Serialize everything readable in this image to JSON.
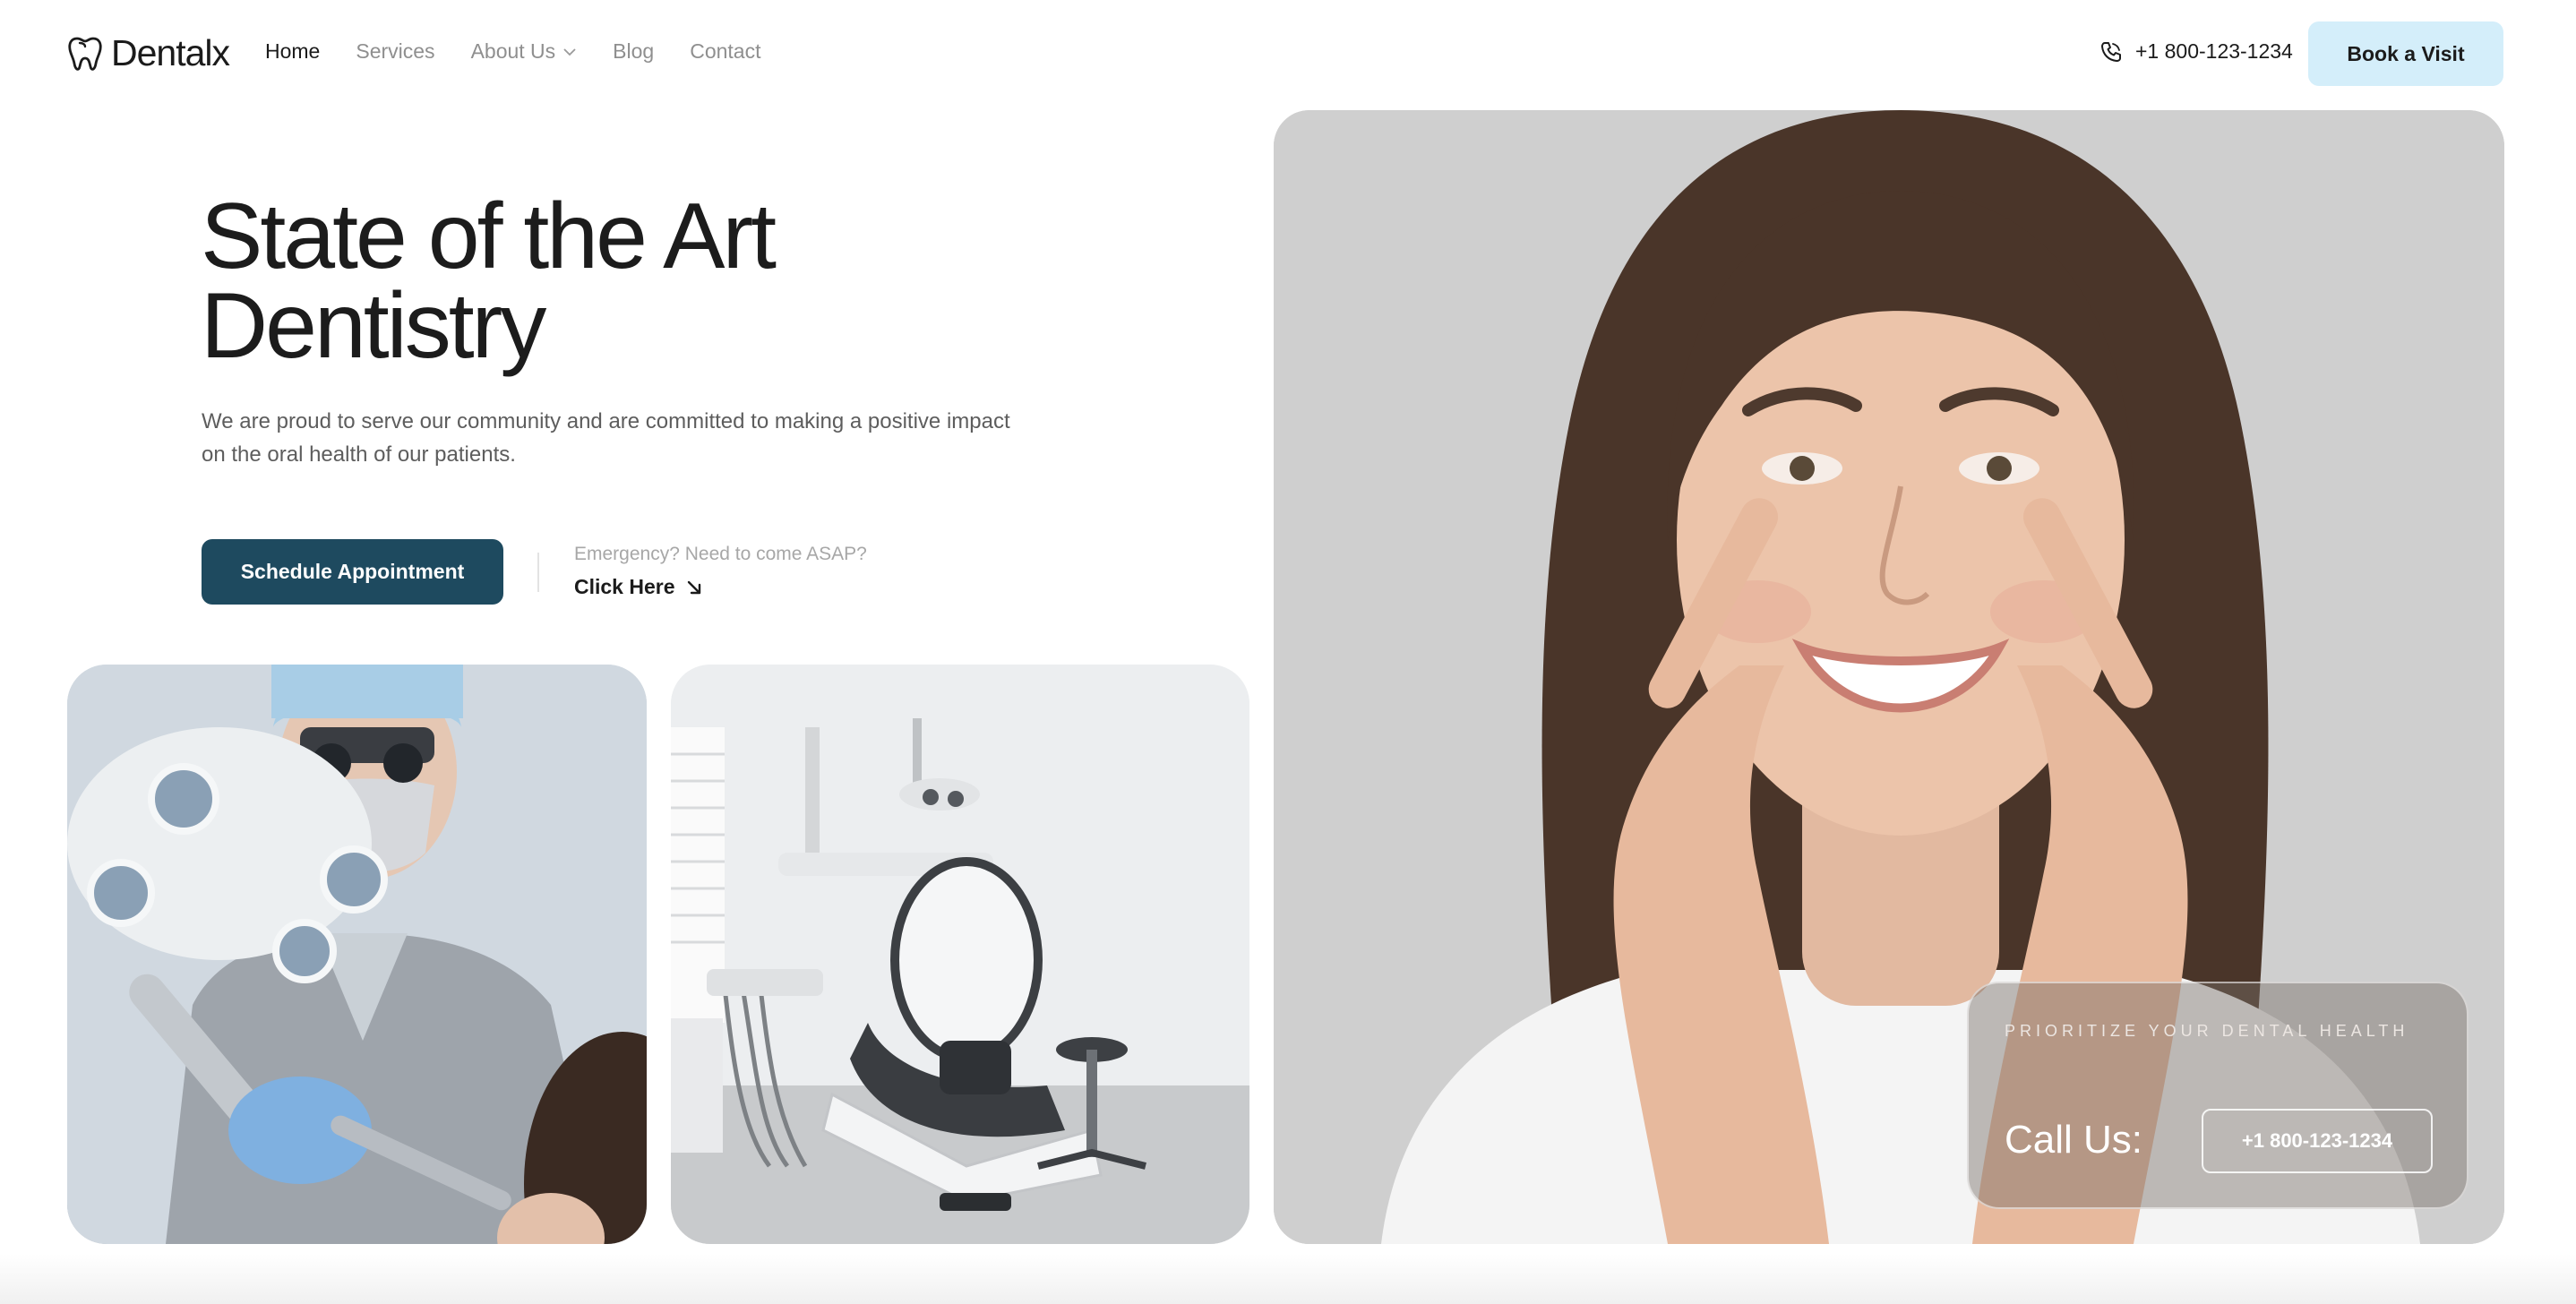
{
  "brand": {
    "name": "Dentalx",
    "icon": "tooth-icon"
  },
  "nav": {
    "links": [
      {
        "label": "Home",
        "active": true
      },
      {
        "label": "Services",
        "active": false
      },
      {
        "label": "About Us",
        "active": false,
        "has_dropdown": true
      },
      {
        "label": "Blog",
        "active": false
      },
      {
        "label": "Contact",
        "active": false
      }
    ],
    "phone": "+1 800-123-1234",
    "phone_icon": "phone-icon",
    "cta_label": "Book a Visit"
  },
  "hero": {
    "title_line1": "State of the Art",
    "title_line2": "Dentistry",
    "description": "We are proud to serve our community and are committed to making a positive impact on the oral health of our patients.",
    "primary_button": "Schedule Appointment",
    "emergency_label": "Emergency? Need to come ASAP?",
    "emergency_link": "Click Here",
    "emergency_link_icon": "arrow-down-right-icon"
  },
  "call_box": {
    "tagline": "PRIORITIZE YOUR DENTAL HEALTH",
    "label": "Call Us:",
    "phone": "+1 800-123-1234"
  },
  "colors": {
    "primary": "#1e4a5f",
    "cta_bg": "#d4eefa",
    "text_dark": "#1c1c1c",
    "text_muted": "#8f8f8f"
  }
}
